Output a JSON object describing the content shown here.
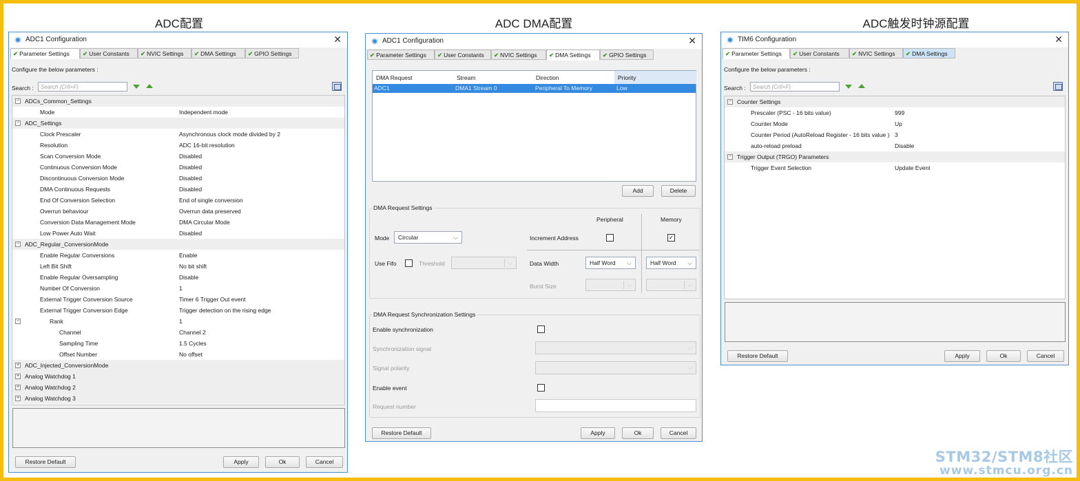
{
  "headings": {
    "adc_config": "ADC配置",
    "adc_dma_config": "ADC DMA配置",
    "adc_trigger_config": "ADC触发时钟源配置"
  },
  "adc_window": {
    "title": "ADC1 Configuration",
    "tabs": [
      "Parameter Settings",
      "User Constants",
      "NVIC Settings",
      "DMA Settings",
      "GPIO Settings"
    ],
    "configure_label": "Configure the below parameters :",
    "search_label": "Search :",
    "search_placeholder": "Search (Crtl+F)",
    "groups": {
      "common": "ADCs_Common_Settings",
      "adc": "ADC_Settings",
      "regular": "ADC_Regular_ConversionMode",
      "injected": "ADC_Injected_ConversionMode",
      "aw1": "Analog Watchdog 1",
      "aw2": "Analog Watchdog 2",
      "aw3": "Analog Watchdog 3"
    },
    "rows": [
      {
        "key": "Mode",
        "value": "Independent mode"
      },
      {
        "key": "Clock Prescaler",
        "value": "Asynchronous clock mode divided by 2"
      },
      {
        "key": "Resolution",
        "value": "ADC 16-bit resolution"
      },
      {
        "key": "Scan Conversion Mode",
        "value": "Disabled"
      },
      {
        "key": "Continuous Conversion Mode",
        "value": "Disabled"
      },
      {
        "key": "Discontinuous Conversion Mode",
        "value": "Disabled"
      },
      {
        "key": "DMA Continuous Requests",
        "value": "Disabled"
      },
      {
        "key": "End Of Conversion Selection",
        "value": "End of single conversion"
      },
      {
        "key": "Overrun behaviour",
        "value": "Overrun data preserved"
      },
      {
        "key": "Conversion Data Management Mode",
        "value": "DMA Circular Mode"
      },
      {
        "key": "Low Power Auto Wait",
        "value": "Disabled"
      },
      {
        "key": "Enable Regular Conversions",
        "value": "Enable"
      },
      {
        "key": "Left Bit Shift",
        "value": "No bit shift"
      },
      {
        "key": "Enable Regular Oversampling",
        "value": "Disable"
      },
      {
        "key": "Number Of Conversion",
        "value": "1"
      },
      {
        "key": "External Trigger Conversion Source",
        "value": "Timer 6 Trigger Out event"
      },
      {
        "key": "External Trigger Conversion Edge",
        "value": "Trigger detection on the rising edge"
      },
      {
        "key": "Rank",
        "value": "1"
      },
      {
        "key": "Channel",
        "value": "Channel 2"
      },
      {
        "key": "Sampling Time",
        "value": "1.5 Cycles"
      },
      {
        "key": "Offset Number",
        "value": "No offset"
      }
    ],
    "buttons": {
      "restore": "Restore Default",
      "apply": "Apply",
      "ok": "Ok",
      "cancel": "Cancel"
    }
  },
  "dma_window": {
    "title": "ADC1 Configuration",
    "tabs": [
      "Parameter Settings",
      "User Constants",
      "NVIC Settings",
      "DMA Settings",
      "GPIO Settings"
    ],
    "table": {
      "headers": [
        "DMA Request",
        "Stream",
        "Direction",
        "Priority"
      ],
      "row": [
        "ADC1",
        "DMA1 Stream 0",
        "Peripheral To Memory",
        "Low"
      ]
    },
    "add": "Add",
    "delete": "Delete",
    "request_settings": {
      "legend": "DMA Request Settings",
      "peripheral": "Peripheral",
      "memory": "Memory",
      "mode_label": "Mode",
      "mode_value": "Circular",
      "increment_address": "Increment Address",
      "peripheral_increment": false,
      "memory_increment": true,
      "use_fifo": "Use Fifo",
      "threshold": "Threshold",
      "data_width": "Data Width",
      "peripheral_width": "Half Word",
      "memory_width": "Half Word",
      "burst_size": "Burst Size"
    },
    "sync_settings": {
      "legend": "DMA Request Synchronization Settings",
      "enable_sync": "Enable synchronization",
      "sync_signal": "Synchronization signal",
      "signal_polarity": "Signal polarity",
      "enable_event": "Enable event",
      "request_number": "Request number"
    },
    "buttons": {
      "restore": "Restore Default",
      "apply": "Apply",
      "ok": "Ok",
      "cancel": "Cancel"
    }
  },
  "tim_window": {
    "title": "TIM6 Configuration",
    "tabs": [
      "Parameter Settings",
      "User Constants",
      "NVIC Settings",
      "DMA Settings"
    ],
    "configure_label": "Configure the below parameters :",
    "search_label": "Search :",
    "search_placeholder": "Search (Crtl+F)",
    "groups": {
      "counter": "Counter Settings",
      "trgo": "Trigger Output (TRGO) Parameters"
    },
    "rows": [
      {
        "key": "Prescaler (PSC - 16 bits value)",
        "value": "999"
      },
      {
        "key": "Counter Mode",
        "value": "Up"
      },
      {
        "key": "Counter Period (AutoReload Register - 16 bits value )",
        "value": "3"
      },
      {
        "key": "auto-reload preload",
        "value": "Disable"
      },
      {
        "key": "Trigger Event Selection",
        "value": "Update Event"
      }
    ],
    "buttons": {
      "restore": "Restore Default",
      "apply": "Apply",
      "ok": "Ok",
      "cancel": "Cancel"
    }
  },
  "watermark": {
    "line1": "STM32/STM8社区",
    "line2": "www.stmcu.org.cn"
  },
  "colors": {
    "frame": "#f6bd0c",
    "selection": "#3489e0",
    "check": "#3d9a27",
    "window_border": "#4a8fd0"
  }
}
